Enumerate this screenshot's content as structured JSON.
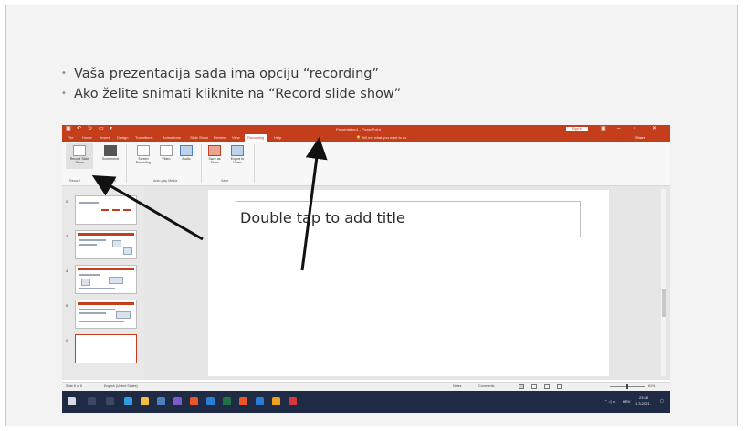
{
  "slide": {
    "bullets": [
      "Vaša prezentacija sada ima opciju “recording”",
      "Ako želite snimati kliknite na  “Record slide show”"
    ]
  },
  "window": {
    "app_title": "Presentation1 - PowerPoint",
    "sign_in": "Sign in",
    "tabs": [
      "File",
      "Home",
      "Insert",
      "Design",
      "Transitions",
      "Animations",
      "Slide Show",
      "Review",
      "View",
      "Recording",
      "Help"
    ],
    "active_tab": "Recording",
    "tell_me": "Tell me what you want to do",
    "share": "Share"
  },
  "ribbon": {
    "record_slide_show": "Record Slide Show",
    "screenshot": "Screenshot",
    "screen_recording": "Screen Recording",
    "video": "Video",
    "audio": "Audio",
    "save_as_show": "Save as Show",
    "export_to_video": "Export to Video",
    "groups": [
      "Record",
      "Content",
      "Auto-play Media",
      "Save"
    ]
  },
  "thumbnails": [
    "2",
    "3",
    "4",
    "5",
    "6"
  ],
  "editor": {
    "title_placeholder": "Double tap to add title"
  },
  "statusbar": {
    "slide_info": "Slide 6 of 6",
    "language": "English (United States)",
    "notes": "Notes",
    "comments": "Comments",
    "zoom": "61%"
  },
  "taskbar": {
    "lang": "HRV",
    "time": "23:48",
    "date": "1.3.2021."
  },
  "colors": {
    "ppt_accent": "#c43e1c",
    "taskbar": "#1f2a44",
    "arrow": "#111111"
  }
}
